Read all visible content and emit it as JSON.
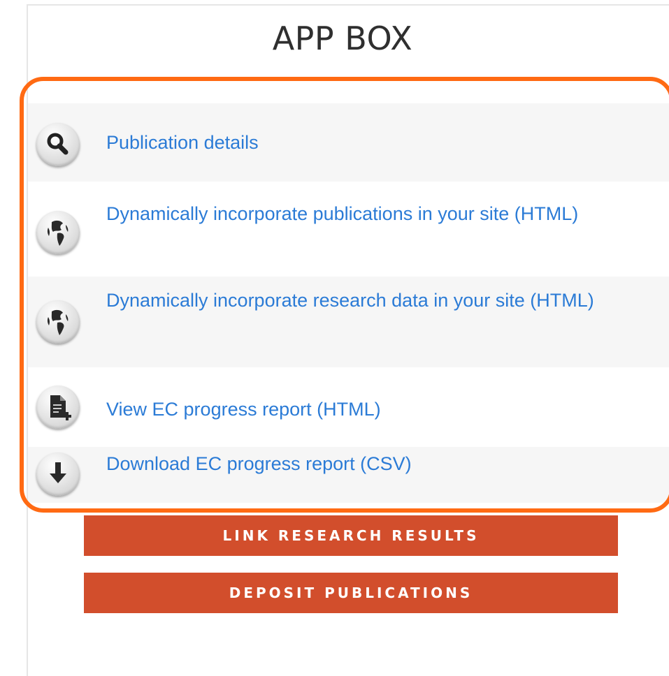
{
  "app_box": {
    "title": "APP BOX",
    "items": [
      {
        "icon": "search-icon",
        "label": "Publication details"
      },
      {
        "icon": "globe-icon",
        "label": "Dynamically incorporate publications in your site (HTML)"
      },
      {
        "icon": "globe-icon",
        "label": "Dynamically incorporate research data in your site (HTML)"
      },
      {
        "icon": "add-document-icon",
        "label": "View EC progress report (HTML)"
      },
      {
        "icon": "download-arrow-icon",
        "label": "Download EC progress report (CSV)"
      }
    ],
    "highlight_color": "#ff6a13"
  },
  "actions": {
    "link_research_results": "LINK RESEARCH RESULTS",
    "deposit_publications": "DEPOSIT PUBLICATIONS",
    "button_color": "#d24e2c"
  },
  "colors": {
    "link": "#2b7bd6",
    "item_background": "#f6f6f6"
  }
}
